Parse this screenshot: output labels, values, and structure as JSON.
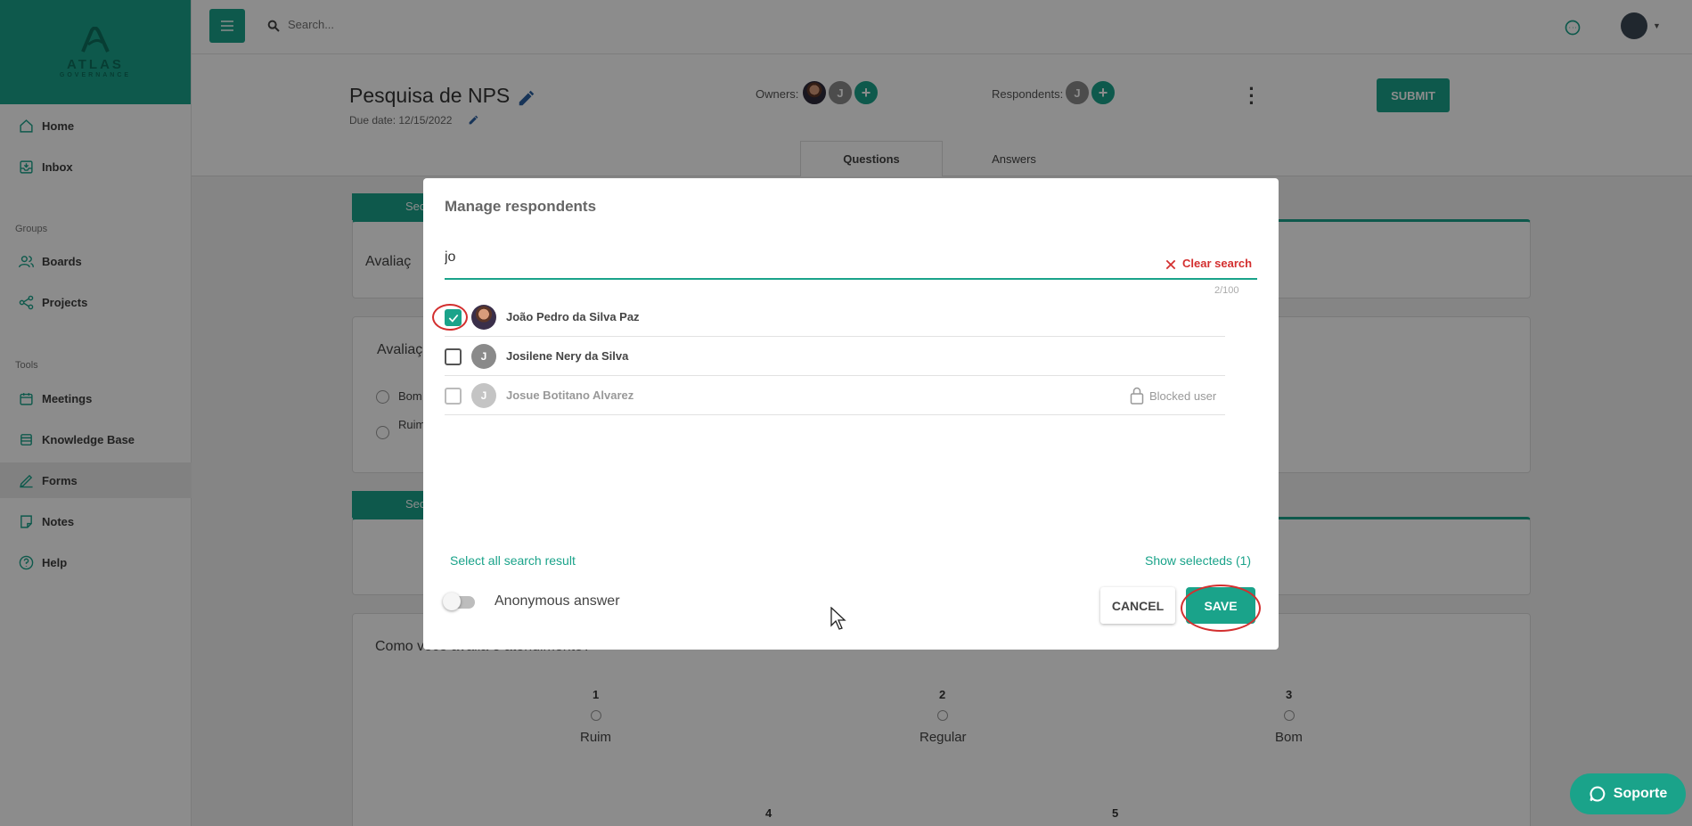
{
  "brand": {
    "logo_word": "ATLAS",
    "logo_sub": "GOVERNANCE"
  },
  "sidebar": {
    "items": [
      {
        "label": "Home",
        "icon": "home-icon"
      },
      {
        "label": "Inbox",
        "icon": "inbox-icon"
      },
      {
        "label": "Boards",
        "icon": "users-icon"
      },
      {
        "label": "Projects",
        "icon": "share-icon"
      },
      {
        "label": "Meetings",
        "icon": "calendar-icon"
      },
      {
        "label": "Knowledge Base",
        "icon": "layers-icon"
      },
      {
        "label": "Forms",
        "icon": "pen-icon",
        "active": true
      },
      {
        "label": "Notes",
        "icon": "note-icon"
      },
      {
        "label": "Help",
        "icon": "help-icon"
      }
    ],
    "groups_label": "Groups",
    "tools_label": "Tools"
  },
  "topbar": {
    "search_placeholder": "Search..."
  },
  "form": {
    "title": "Pesquisa de NPS",
    "due_date": "Due date: 12/15/2022",
    "owners_label": "Owners:",
    "respondents_label": "Respondents:",
    "owner_initial": "J",
    "respondent_initial": "J",
    "submit_label": "SUBMIT",
    "tabs": [
      "Questions",
      "Answers"
    ]
  },
  "background_cards": {
    "section_tab_1": "Sec",
    "section_tab_2": "Sec",
    "card1_text": "Avaliaç",
    "card2_title": "Avaliaç",
    "card2_option1": "Bom",
    "card2_option2": "Ruim",
    "card4_question": "Como você avalia o atendimento?",
    "scale": [
      {
        "num": "1",
        "label": "Ruim"
      },
      {
        "num": "2",
        "label": "Regular"
      },
      {
        "num": "3",
        "label": "Bom"
      },
      {
        "num": "4",
        "label": ""
      },
      {
        "num": "5",
        "label": ""
      }
    ]
  },
  "modal": {
    "title": "Manage respondents",
    "search_value": "jo",
    "clear_label": "Clear search",
    "counter": "2/100",
    "rows": [
      {
        "name": "João Pedro da Silva Paz",
        "checked": true,
        "avatar": "photo"
      },
      {
        "name": "Josilene Nery da Silva",
        "checked": false,
        "initial": "J"
      },
      {
        "name": "Josue Botitano Alvarez",
        "checked": false,
        "initial": "J",
        "blocked": true,
        "blocked_label": "Blocked user"
      }
    ],
    "select_all_label": "Select all search result",
    "show_selected_label": "Show selecteds (1)",
    "anonymous_label": "Anonymous answer",
    "anonymous_on": false,
    "cancel_label": "CANCEL",
    "save_label": "SAVE"
  },
  "support": {
    "label": "Soporte"
  },
  "colors": {
    "accent": "#1aa38a",
    "danger": "#d32f2f"
  }
}
